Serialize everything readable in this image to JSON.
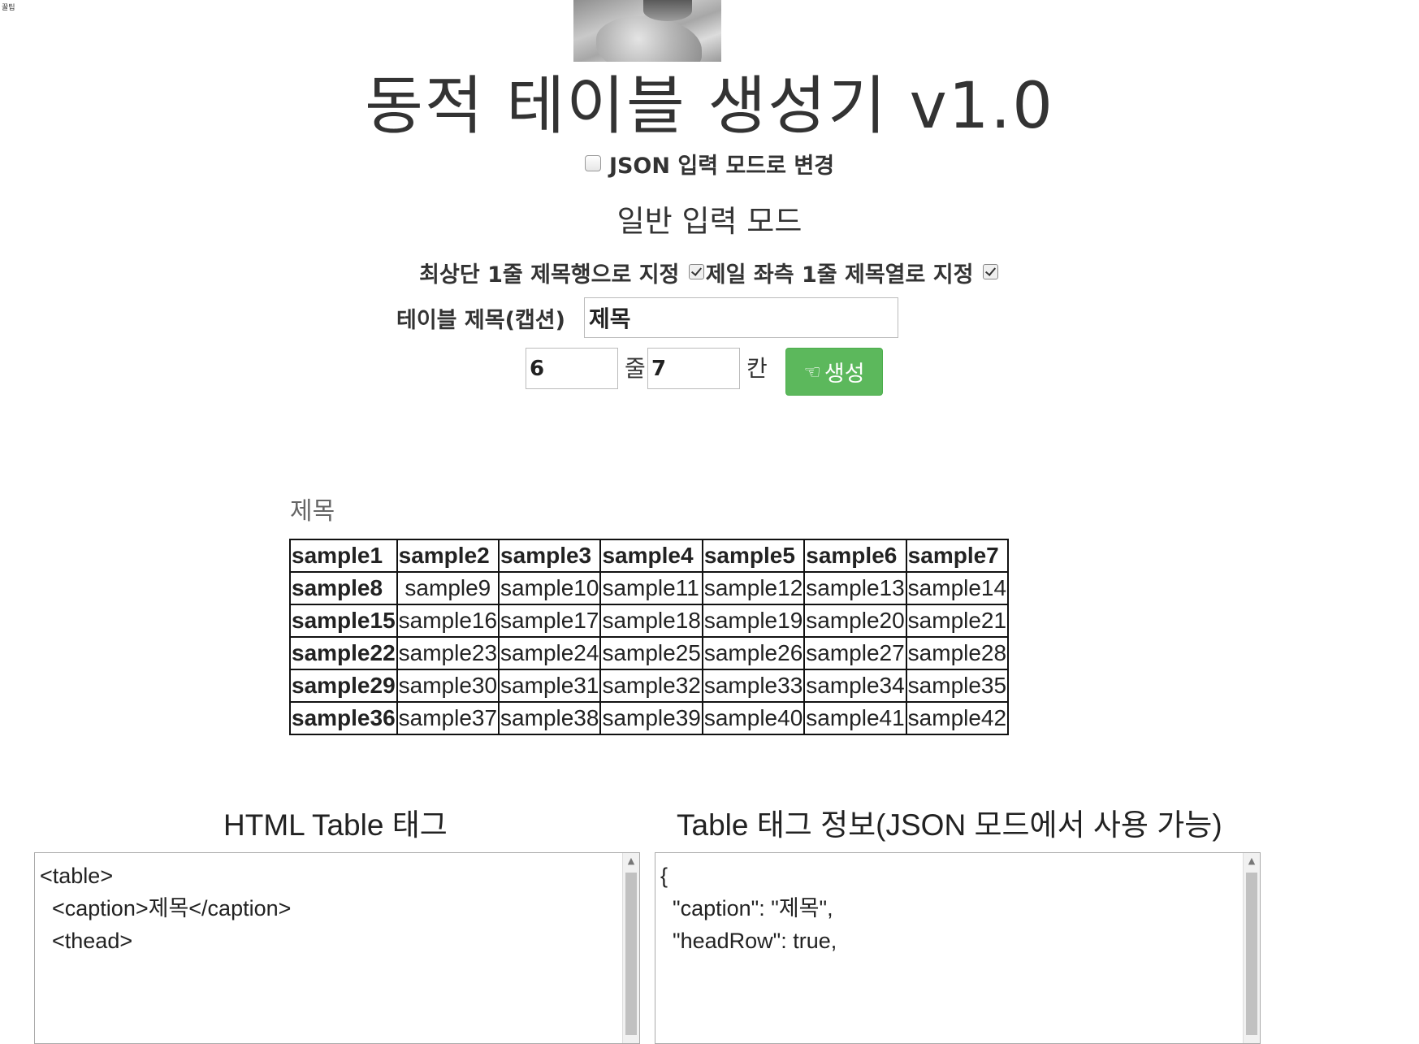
{
  "corner_text": "꿀팁",
  "title": "동적 테이블 생성기 v1.0",
  "json_mode": {
    "label": "JSON 입력 모드로 변경",
    "checked": false
  },
  "mode_title": "일반 입력 모드",
  "options": {
    "head_row_label": "최상단 1줄 제목행으로 지정",
    "head_row_checked": true,
    "head_col_label": "제일 좌측 1줄 제목열로 지정",
    "head_col_checked": true
  },
  "caption_field": {
    "label": "테이블 제목(캡션)",
    "value": "제목"
  },
  "size": {
    "rows_value": "6",
    "rows_unit": "줄",
    "cols_value": "7",
    "cols_unit": "칸"
  },
  "generate_button": {
    "label": "생성"
  },
  "table": {
    "caption": "제목",
    "rows": [
      [
        "sample1",
        "sample2",
        "sample3",
        "sample4",
        "sample5",
        "sample6",
        "sample7"
      ],
      [
        "sample8",
        "sample9",
        "sample10",
        "sample11",
        "sample12",
        "sample13",
        "sample14"
      ],
      [
        "sample15",
        "sample16",
        "sample17",
        "sample18",
        "sample19",
        "sample20",
        "sample21"
      ],
      [
        "sample22",
        "sample23",
        "sample24",
        "sample25",
        "sample26",
        "sample27",
        "sample28"
      ],
      [
        "sample29",
        "sample30",
        "sample31",
        "sample32",
        "sample33",
        "sample34",
        "sample35"
      ],
      [
        "sample36",
        "sample37",
        "sample38",
        "sample39",
        "sample40",
        "sample41",
        "sample42"
      ]
    ]
  },
  "html_section": {
    "title": "HTML Table 태그",
    "code": "<table>\n  <caption>제목</caption>\n  <thead>"
  },
  "json_section": {
    "title": "Table 태그 정보(JSON 모드에서 사용 가능)",
    "code": "{\n  \"caption\": \"제목\",\n  \"headRow\": true,"
  }
}
